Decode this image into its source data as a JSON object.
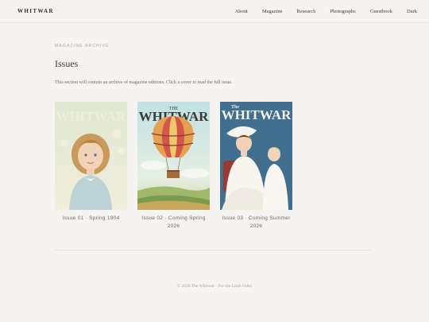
{
  "header": {
    "brand": "WHITWAR",
    "nav": [
      "About",
      "Magazine",
      "Research",
      "Photographs",
      "Guestbook",
      "Dark"
    ]
  },
  "main": {
    "eyebrow": "MAGAZINE ARCHIVE",
    "title": "Issues",
    "description": "This section will contain an archive of magazine editions. Click a cover to read the full issue.",
    "issues": [
      {
        "cover_title_small": "The",
        "cover_title": "WHITWAR",
        "caption": "Issue 01 · Spring 1904"
      },
      {
        "cover_title_small": "THE",
        "cover_title": "WHITWAR",
        "caption": "Issue 02 · Coming Spring 2026"
      },
      {
        "cover_title_small": "The",
        "cover_title": "WHITWAR",
        "caption": "Issue 03 · Coming Summer 2026"
      }
    ]
  },
  "footer": {
    "text": "© 2026 The Whitwar · For the Little Folks"
  },
  "colors": {
    "background": "#f5f4f0",
    "cover1_bg": "#e9ecd9",
    "cover2_sky": "#cfe5e6",
    "cover3_bg": "#3f6f8f"
  }
}
